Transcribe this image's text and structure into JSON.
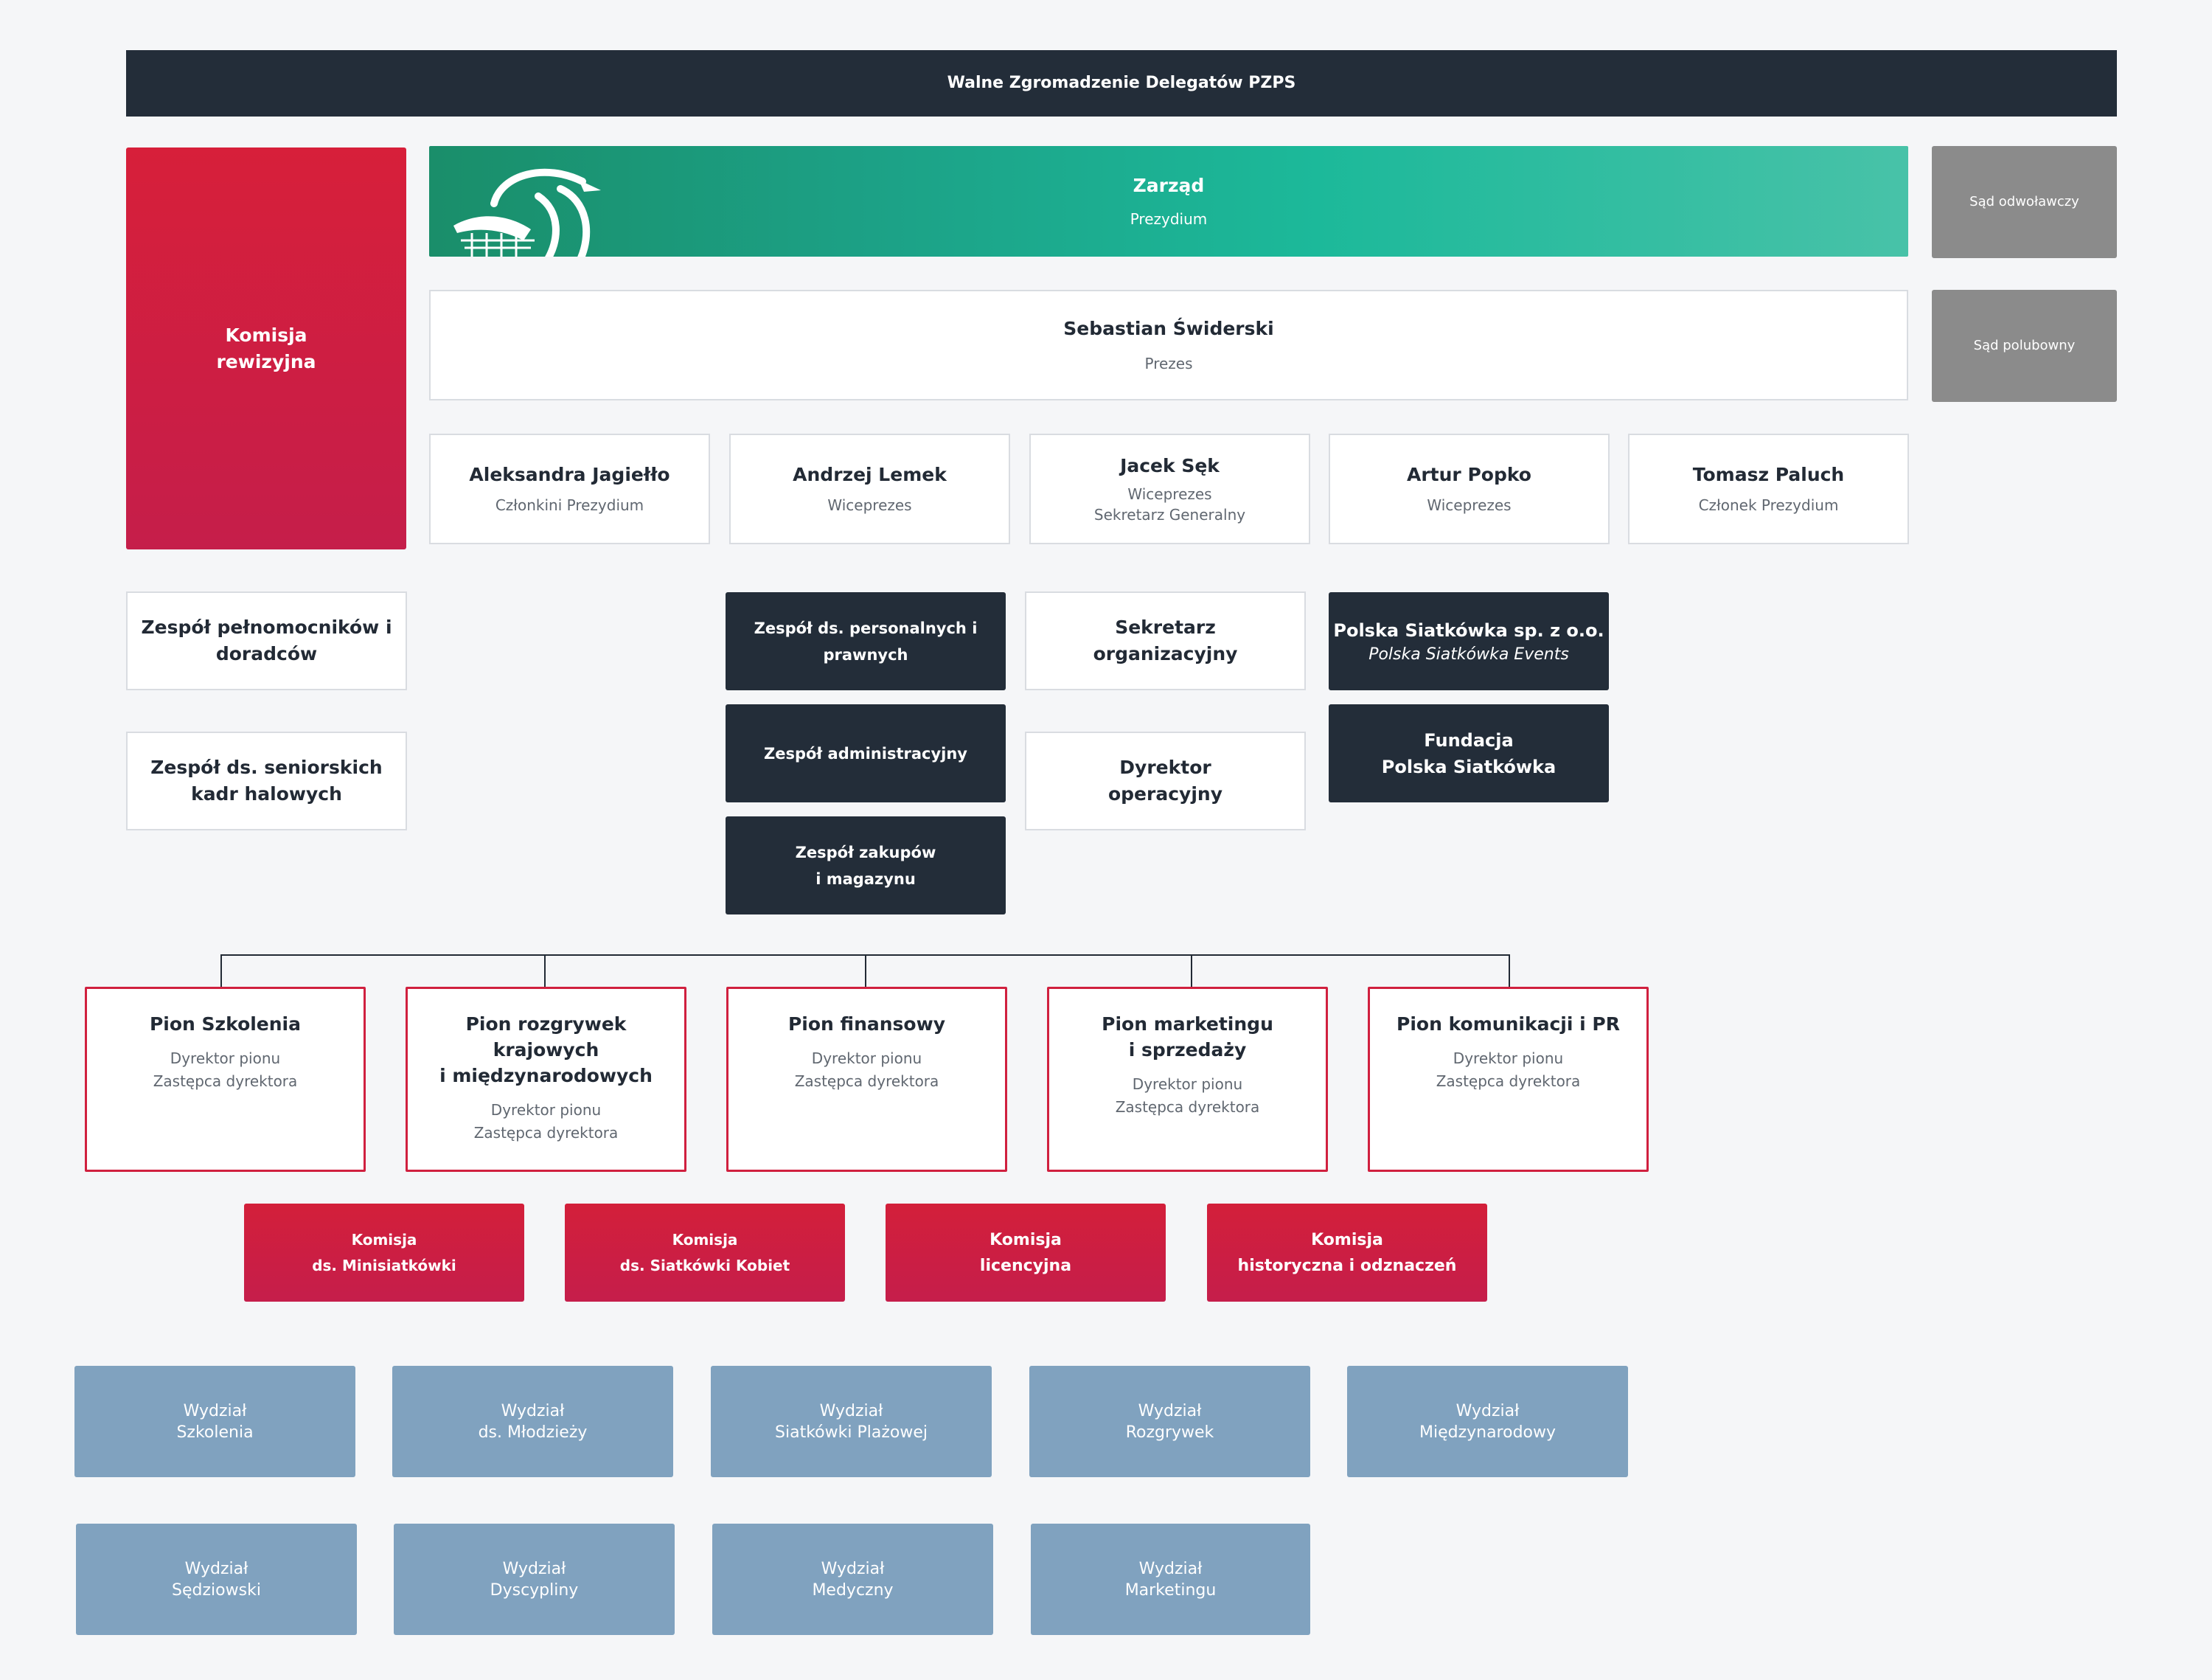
{
  "header": {
    "title": "Walne Zgromadzenie Delegatów PZPS"
  },
  "komisja_rewizyjna": {
    "line1": "Komisja",
    "line2": "rewizyjna"
  },
  "zarzad": {
    "title": "Zarząd",
    "subtitle": "Prezydium",
    "logo_icon": "pzps-eagle-logo-icon"
  },
  "courts": {
    "appeal": "Sąd odwoławczy",
    "arbitration": "Sąd polubowny"
  },
  "president": {
    "name": "Sebastian Świderski",
    "role": "Prezes"
  },
  "members": [
    {
      "name": "Aleksandra Jagiełło",
      "role": "Członkini Prezydium",
      "role2": ""
    },
    {
      "name": "Andrzej Lemek",
      "role": "Wiceprezes",
      "role2": ""
    },
    {
      "name": "Jacek Sęk",
      "role": "Wiceprezes",
      "role2": "Sekretarz Generalny"
    },
    {
      "name": "Artur Popko",
      "role": "Wiceprezes",
      "role2": ""
    },
    {
      "name": "Tomasz Paluch",
      "role": "Członek Prezydium",
      "role2": ""
    }
  ],
  "left_teams": [
    {
      "line1": "Zespół pełnomocników i",
      "line2": "doradców"
    },
    {
      "line1": "Zespół ds. seniorskich",
      "line2": "kadr halowych"
    }
  ],
  "dark_teams": [
    {
      "line1": "Zespół ds. personalnych i",
      "line2": "prawnych"
    },
    {
      "line1": "Zespół administracyjny",
      "line2": ""
    },
    {
      "line1": "Zespół zakupów",
      "line2": "i magazynu"
    }
  ],
  "secretary": {
    "line1": "Sekretarz",
    "line2": "organizacyjny"
  },
  "director": {
    "line1": "Dyrektor",
    "line2": "operacyjny"
  },
  "companies": [
    {
      "line1": "Polska Siatkówka sp. z o.o.",
      "line2": "Polska Siatkówka Events"
    },
    {
      "line1": "Fundacja",
      "line2": "Polska Siatkówka"
    }
  ],
  "pions": [
    {
      "title_lines": [
        "Pion Szkolenia"
      ],
      "sub": [
        "Dyrektor pionu",
        "Zastępca dyrektora"
      ]
    },
    {
      "title_lines": [
        "Pion rozgrywek",
        "krajowych",
        "i międzynarodowych"
      ],
      "sub": [
        "Dyrektor pionu",
        "Zastępca dyrektora"
      ]
    },
    {
      "title_lines": [
        "Pion finansowy"
      ],
      "sub": [
        "Dyrektor pionu",
        "Zastępca dyrektora"
      ]
    },
    {
      "title_lines": [
        "Pion marketingu",
        "i sprzedaży"
      ],
      "sub": [
        "Dyrektor pionu",
        "Zastępca dyrektora"
      ]
    },
    {
      "title_lines": [
        "Pion komunikacji i PR"
      ],
      "sub": [
        "Dyrektor pionu",
        "Zastępca dyrektora"
      ]
    }
  ],
  "commissions": [
    {
      "line1": "Komisja",
      "line2": "ds. Minisiatkówki"
    },
    {
      "line1": "Komisja",
      "line2": "ds. Siatkówki Kobiet"
    },
    {
      "line1": "Komisja",
      "line2": "licencyjna"
    },
    {
      "line1": "Komisja",
      "line2": "historyczna i odznaczeń"
    }
  ],
  "departments": [
    {
      "line1": "Wydział",
      "line2": "Szkolenia"
    },
    {
      "line1": "Wydział",
      "line2": "ds. Młodzieży"
    },
    {
      "line1": "Wydział",
      "line2": "Siatkówki Plażowej"
    },
    {
      "line1": "Wydział",
      "line2": "Rozgrywek"
    },
    {
      "line1": "Wydział",
      "line2": "Międzynarodowy"
    },
    {
      "line1": "Wydział",
      "line2": "Sędziowski"
    },
    {
      "line1": "Wydział",
      "line2": "Dyscypliny"
    },
    {
      "line1": "Wydział",
      "line2": "Medyczny"
    },
    {
      "line1": "Wydział",
      "line2": "Marketingu"
    }
  ],
  "colors": {
    "header_bg": "#232d39",
    "accent_red": "#d0203f",
    "accent_green": "#1cb99a",
    "court_grey": "#8b8b8b",
    "department_blue": "#80a2bf"
  }
}
